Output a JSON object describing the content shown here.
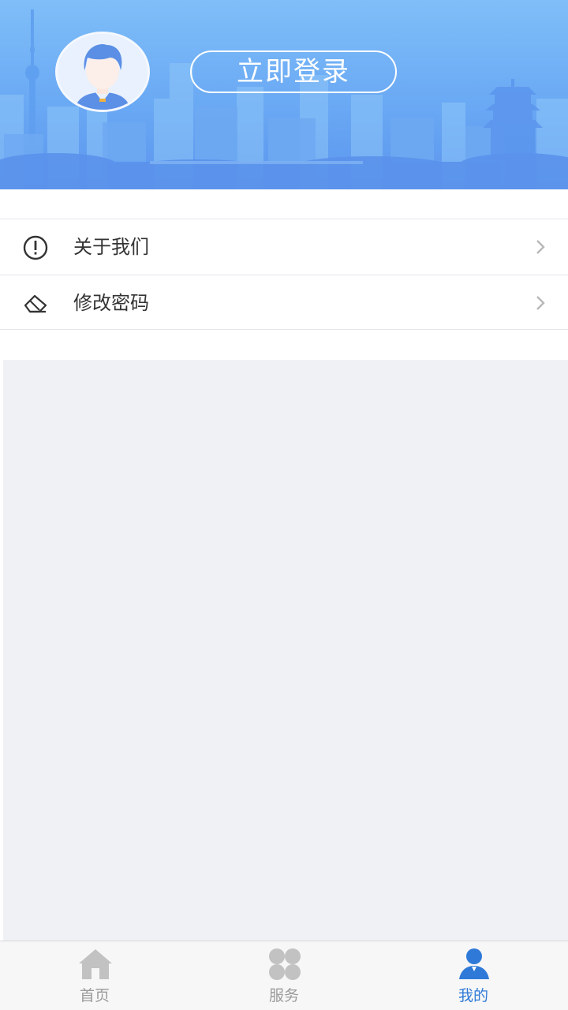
{
  "header": {
    "login_label": "立即登录"
  },
  "menu": {
    "items": [
      {
        "label": "关于我们",
        "icon": "info-circle-icon"
      },
      {
        "label": "修改密码",
        "icon": "eraser-icon"
      }
    ]
  },
  "tabbar": {
    "tabs": [
      {
        "label": "首页",
        "icon": "home-icon",
        "active": false
      },
      {
        "label": "服务",
        "icon": "grid-icon",
        "active": false
      },
      {
        "label": "我的",
        "icon": "user-icon",
        "active": true
      }
    ]
  },
  "colors": {
    "header_top": "#7fbef8",
    "header_bottom": "#5b95ee",
    "active_tab": "#2f7ad8",
    "inactive_tab": "#9a9a9a",
    "content_bg": "#eff1f5"
  }
}
